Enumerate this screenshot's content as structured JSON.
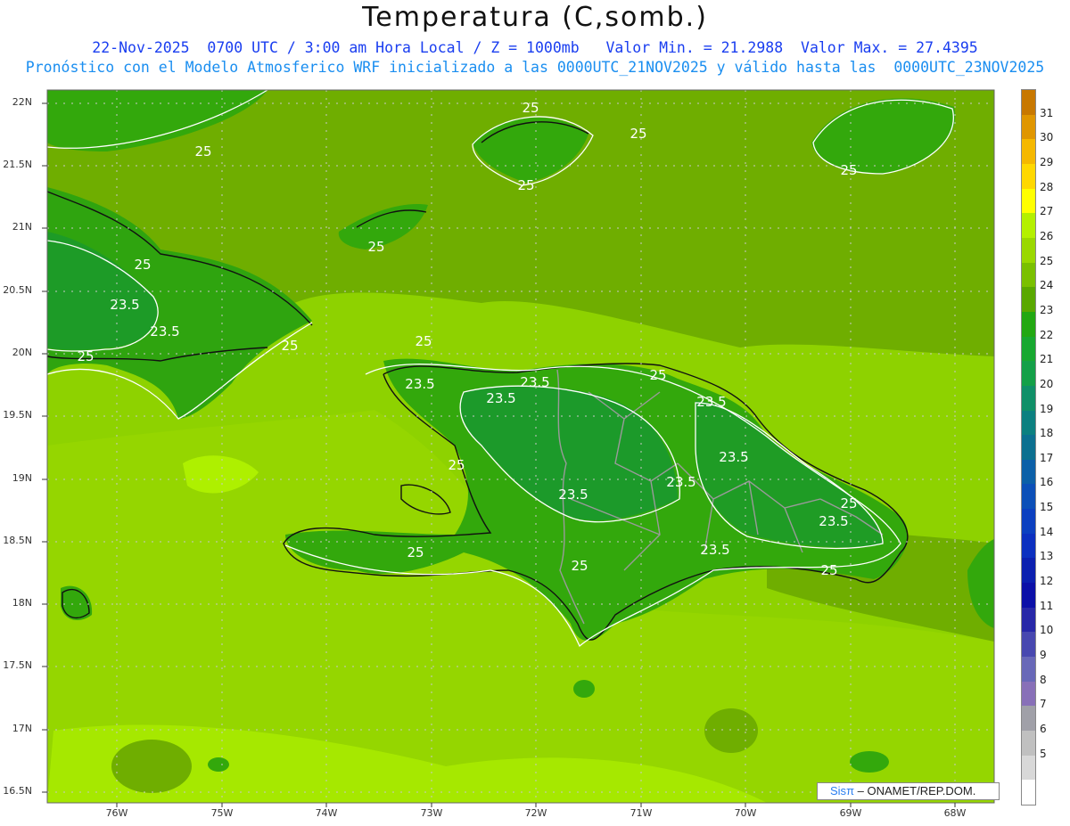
{
  "header": {
    "title": "Temperatura (C,somb.)",
    "line1": "22-Nov-2025  0700 UTC / 3:00 am Hora Local / Z = 1000mb   Valor Min. = 21.2988  Valor Max. = 27.4395",
    "line2": "Pronóstico con el Modelo Atmosferico WRF inicializado a las 0000UTC_21NOV2025 y válido hasta las  0000UTC_23NOV2025"
  },
  "axes": {
    "lat_ticks": [
      "22N",
      "21.5N",
      "21N",
      "20.5N",
      "20N",
      "19.5N",
      "19N",
      "18.5N",
      "18N",
      "17.5N",
      "17N",
      "16.5N"
    ],
    "lon_ticks": [
      "76W",
      "75W",
      "74W",
      "73W",
      "72W",
      "71W",
      "70W",
      "69W",
      "68W"
    ]
  },
  "contour_labels": [
    "25",
    "25",
    "25",
    "25",
    "25",
    "25",
    "25",
    "25",
    "25",
    "25",
    "25",
    "25",
    "25",
    "23.5",
    "23.5",
    "23.5",
    "23.5",
    "23.5",
    "23.5",
    "23.5",
    "23.5",
    "23.5",
    "23.5",
    "23.5",
    "25",
    "25",
    "25"
  ],
  "colorbar": {
    "labels": [
      "31",
      "30",
      "29",
      "28",
      "27",
      "26",
      "25",
      "24",
      "23",
      "22",
      "21",
      "20",
      "19",
      "18",
      "17",
      "16",
      "15",
      "14",
      "13",
      "12",
      "11",
      "10",
      "9",
      "8",
      "7",
      "6",
      "5"
    ],
    "colors": [
      "#c87800",
      "#e09600",
      "#f5b800",
      "#ffd800",
      "#ffff00",
      "#b4f000",
      "#9ad800",
      "#7ac000",
      "#5aa800",
      "#22a812",
      "#18a830",
      "#14a048",
      "#109068",
      "#0c8080",
      "#0c7090",
      "#0c60a8",
      "#0c50b8",
      "#0c40c0",
      "#0c30c0",
      "#0c20b0",
      "#0c10a8",
      "#2828a8",
      "#4848b0",
      "#6868b8",
      "#8870b8",
      "#a0a0a8",
      "#c0c0c0",
      "#d8d8d8",
      "#ffffff"
    ]
  },
  "credit": {
    "brand": "Sis",
    "pi": "π",
    "text": "– ONAMET/REP.DOM."
  }
}
